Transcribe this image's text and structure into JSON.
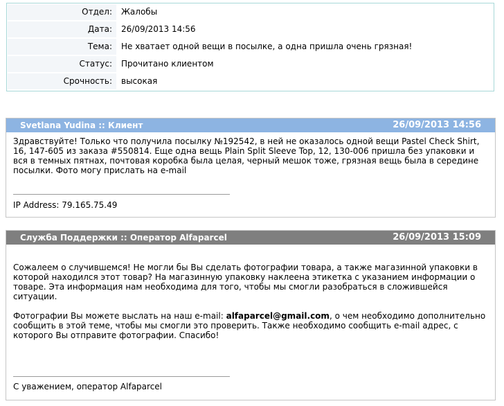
{
  "ticket": {
    "rows": [
      {
        "label": "Отдел:",
        "value": "Жалобы"
      },
      {
        "label": "Дата:",
        "value": "26/09/2013 14:56"
      },
      {
        "label": "Тема:",
        "value": "Не хватает одной вещи в посылке, а одна пришла очень грязная!"
      },
      {
        "label": "Статус:",
        "value": "Прочитано клиентом"
      },
      {
        "label": "Срочность:",
        "value": "высокая"
      }
    ]
  },
  "messages": [
    {
      "author": "Svetlana Yudina :: Клиент",
      "date": "26/09/2013 14:56",
      "body": "  Здравствуйте! Только что получила посылку №192542, в ней не оказалось одной вещи Pastel Check Shirt, 16, 147-605 из заказа #550814. Еще одна вещь Plain Split Sleeve Top, 12, 130-006 пришла без упаковки и вся в темных пятнах, почтовая коробка была целая, черный мешок тоже, грязная вещь была в середине посылки. Фото могу прислать на e-mail",
      "footer": "IP Address: 79.165.75.49"
    },
    {
      "author": "Служба Поддержки :: Оператор Alfaparcel",
      "date": "26/09/2013 15:09",
      "para1": "Сожалеем о случившемся! Не могли бы Вы сделать фотографии товара, а также магазинной упаковки в которой находился этот товар? На магазинную упаковку наклеена этикетка с указанием информации о товаре. Эта информация нам необходима для того, чтобы мы смогли разобраться в сложившейся ситуации.",
      "para2_before": "Фотографии Вы можете выслать на наш e-mail: ",
      "email": "alfaparcel@gmail.com",
      "para2_after": ", о чем необходимо дополнительно сообщить в этой теме, чтобы мы смогли это проверить. Также необходимо сообщить e-mail адрес, с которого Вы отправите фотографии. Спасибо!",
      "footer": "С уважением, оператор Alfaparcel"
    }
  ],
  "colors": {
    "client_header": "#8db4e2",
    "staff_header": "#7f7f7f",
    "info_border": "#a8d8d8",
    "label_bg": "#f3f6f9"
  }
}
